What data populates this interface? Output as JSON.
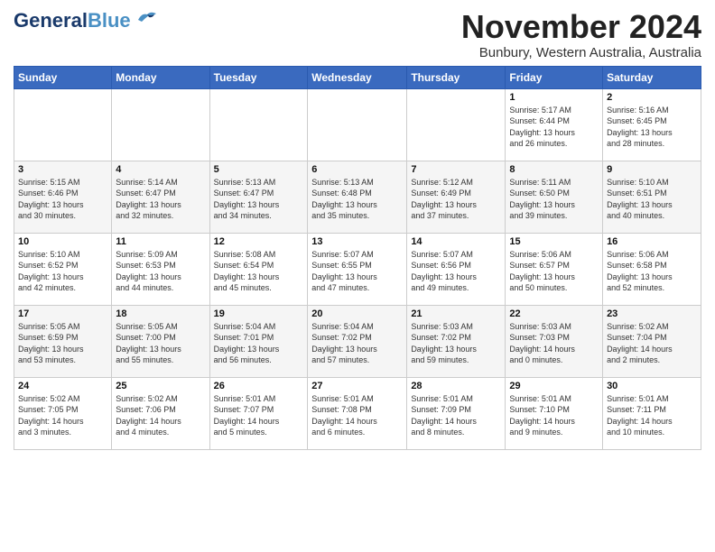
{
  "logo": {
    "text_general": "General",
    "text_blue": "Blue"
  },
  "header": {
    "month_year": "November 2024",
    "location": "Bunbury, Western Australia, Australia"
  },
  "weekdays": [
    "Sunday",
    "Monday",
    "Tuesday",
    "Wednesday",
    "Thursday",
    "Friday",
    "Saturday"
  ],
  "weeks": [
    [
      {
        "day": "",
        "info": ""
      },
      {
        "day": "",
        "info": ""
      },
      {
        "day": "",
        "info": ""
      },
      {
        "day": "",
        "info": ""
      },
      {
        "day": "",
        "info": ""
      },
      {
        "day": "1",
        "info": "Sunrise: 5:17 AM\nSunset: 6:44 PM\nDaylight: 13 hours\nand 26 minutes."
      },
      {
        "day": "2",
        "info": "Sunrise: 5:16 AM\nSunset: 6:45 PM\nDaylight: 13 hours\nand 28 minutes."
      }
    ],
    [
      {
        "day": "3",
        "info": "Sunrise: 5:15 AM\nSunset: 6:46 PM\nDaylight: 13 hours\nand 30 minutes."
      },
      {
        "day": "4",
        "info": "Sunrise: 5:14 AM\nSunset: 6:47 PM\nDaylight: 13 hours\nand 32 minutes."
      },
      {
        "day": "5",
        "info": "Sunrise: 5:13 AM\nSunset: 6:47 PM\nDaylight: 13 hours\nand 34 minutes."
      },
      {
        "day": "6",
        "info": "Sunrise: 5:13 AM\nSunset: 6:48 PM\nDaylight: 13 hours\nand 35 minutes."
      },
      {
        "day": "7",
        "info": "Sunrise: 5:12 AM\nSunset: 6:49 PM\nDaylight: 13 hours\nand 37 minutes."
      },
      {
        "day": "8",
        "info": "Sunrise: 5:11 AM\nSunset: 6:50 PM\nDaylight: 13 hours\nand 39 minutes."
      },
      {
        "day": "9",
        "info": "Sunrise: 5:10 AM\nSunset: 6:51 PM\nDaylight: 13 hours\nand 40 minutes."
      }
    ],
    [
      {
        "day": "10",
        "info": "Sunrise: 5:10 AM\nSunset: 6:52 PM\nDaylight: 13 hours\nand 42 minutes."
      },
      {
        "day": "11",
        "info": "Sunrise: 5:09 AM\nSunset: 6:53 PM\nDaylight: 13 hours\nand 44 minutes."
      },
      {
        "day": "12",
        "info": "Sunrise: 5:08 AM\nSunset: 6:54 PM\nDaylight: 13 hours\nand 45 minutes."
      },
      {
        "day": "13",
        "info": "Sunrise: 5:07 AM\nSunset: 6:55 PM\nDaylight: 13 hours\nand 47 minutes."
      },
      {
        "day": "14",
        "info": "Sunrise: 5:07 AM\nSunset: 6:56 PM\nDaylight: 13 hours\nand 49 minutes."
      },
      {
        "day": "15",
        "info": "Sunrise: 5:06 AM\nSunset: 6:57 PM\nDaylight: 13 hours\nand 50 minutes."
      },
      {
        "day": "16",
        "info": "Sunrise: 5:06 AM\nSunset: 6:58 PM\nDaylight: 13 hours\nand 52 minutes."
      }
    ],
    [
      {
        "day": "17",
        "info": "Sunrise: 5:05 AM\nSunset: 6:59 PM\nDaylight: 13 hours\nand 53 minutes."
      },
      {
        "day": "18",
        "info": "Sunrise: 5:05 AM\nSunset: 7:00 PM\nDaylight: 13 hours\nand 55 minutes."
      },
      {
        "day": "19",
        "info": "Sunrise: 5:04 AM\nSunset: 7:01 PM\nDaylight: 13 hours\nand 56 minutes."
      },
      {
        "day": "20",
        "info": "Sunrise: 5:04 AM\nSunset: 7:02 PM\nDaylight: 13 hours\nand 57 minutes."
      },
      {
        "day": "21",
        "info": "Sunrise: 5:03 AM\nSunset: 7:02 PM\nDaylight: 13 hours\nand 59 minutes."
      },
      {
        "day": "22",
        "info": "Sunrise: 5:03 AM\nSunset: 7:03 PM\nDaylight: 14 hours\nand 0 minutes."
      },
      {
        "day": "23",
        "info": "Sunrise: 5:02 AM\nSunset: 7:04 PM\nDaylight: 14 hours\nand 2 minutes."
      }
    ],
    [
      {
        "day": "24",
        "info": "Sunrise: 5:02 AM\nSunset: 7:05 PM\nDaylight: 14 hours\nand 3 minutes."
      },
      {
        "day": "25",
        "info": "Sunrise: 5:02 AM\nSunset: 7:06 PM\nDaylight: 14 hours\nand 4 minutes."
      },
      {
        "day": "26",
        "info": "Sunrise: 5:01 AM\nSunset: 7:07 PM\nDaylight: 14 hours\nand 5 minutes."
      },
      {
        "day": "27",
        "info": "Sunrise: 5:01 AM\nSunset: 7:08 PM\nDaylight: 14 hours\nand 6 minutes."
      },
      {
        "day": "28",
        "info": "Sunrise: 5:01 AM\nSunset: 7:09 PM\nDaylight: 14 hours\nand 8 minutes."
      },
      {
        "day": "29",
        "info": "Sunrise: 5:01 AM\nSunset: 7:10 PM\nDaylight: 14 hours\nand 9 minutes."
      },
      {
        "day": "30",
        "info": "Sunrise: 5:01 AM\nSunset: 7:11 PM\nDaylight: 14 hours\nand 10 minutes."
      }
    ]
  ]
}
